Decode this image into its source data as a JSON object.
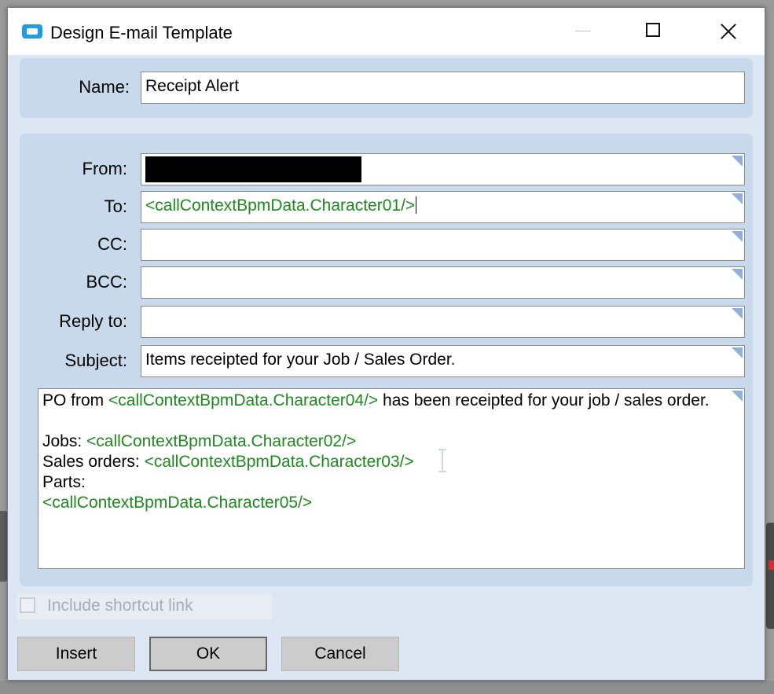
{
  "window": {
    "title": "Design E-mail Template"
  },
  "name_section": {
    "label": "Name:",
    "value": "Receipt Alert"
  },
  "fields": {
    "from": {
      "label": "From:",
      "value": ""
    },
    "to": {
      "label": "To:",
      "value": "<callContextBpmData.Character01/>"
    },
    "cc": {
      "label": "CC:",
      "value": ""
    },
    "bcc": {
      "label": "BCC:",
      "value": ""
    },
    "reply_to": {
      "label": "Reply to:",
      "value": ""
    },
    "subject": {
      "label": "Subject:",
      "value": "Items receipted for your Job / Sales Order."
    }
  },
  "body": {
    "line1_prefix": "PO from ",
    "line1_token": "<callContextBpmData.Character04/>",
    "line1_suffix": " has been receipted for your job / sales order.",
    "jobs_label": "Jobs: ",
    "jobs_token": "<callContextBpmData.Character02/>",
    "sales_label": "Sales orders: ",
    "sales_token": "<callContextBpmData.Character03/>",
    "parts_label": "Parts:",
    "parts_token": "<callContextBpmData.Character05/>"
  },
  "shortcut": {
    "label": "Include shortcut link",
    "checked": false,
    "enabled": false
  },
  "buttons": {
    "insert": "Insert",
    "ok": "OK",
    "cancel": "Cancel"
  },
  "colors": {
    "token": "#1c8a1c",
    "panel": "#c8d9ec",
    "dialog_bg": "#dde7f3",
    "app_icon": "#1e9ee0"
  }
}
